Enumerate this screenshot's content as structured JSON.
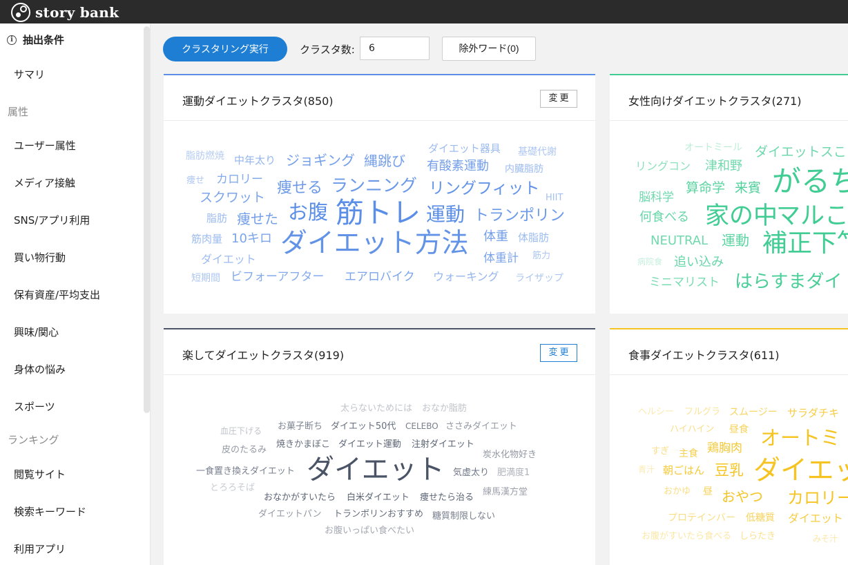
{
  "app": {
    "name": "story bank"
  },
  "sidebar": {
    "header": "抽出条件",
    "summary": "サマリ",
    "section_attr": "属性",
    "items_attr": [
      "ユーザー属性",
      "メディア接触",
      "SNS/アプリ利用",
      "買い物行動",
      "保有資産/平均支出",
      "興味/関心",
      "身体の悩み",
      "スポーツ"
    ],
    "section_rank": "ランキング",
    "items_rank": [
      "閲覧サイト",
      "検索キーワード",
      "利用アプリ"
    ]
  },
  "toolbar": {
    "run_label": "クラスタリング実行",
    "cluster_count_label": "クラスタ数:",
    "cluster_count_value": "6",
    "exclude_label": "除外ワード(0)"
  },
  "colors": {
    "blue": "#5b8ee6",
    "green": "#40cc92",
    "navy": "#4a5466",
    "yellow": "#f5c422",
    "accent": "#1e7ed4"
  },
  "clusters": [
    {
      "title": "運動ダイエットクラスタ(850)",
      "change_label": "変更",
      "words": [
        "脂肪燃焼",
        "中年太り",
        "ジョギング",
        "縄跳び",
        "ダイエット器具",
        "基礎代謝",
        "有酸素運動",
        "内臓脂肪",
        "痩せ",
        "カロリー",
        "痩せる",
        "ランニング",
        "リングフィット",
        "HIIT",
        "スクワット",
        "お腹",
        "筋トレ",
        "運動",
        "トランポリン",
        "脂肪",
        "痩せた",
        "筋肉量",
        "10キロ",
        "ダイエット方法",
        "体重",
        "体脂肪",
        "ダイエット",
        "体重計",
        "筋力",
        "短期間",
        "ビフォーアフター",
        "エアロバイク",
        "ウォーキング",
        "ライザップ"
      ]
    },
    {
      "title": "女性向けダイエットクラスタ(271)",
      "change_label": "",
      "words": [
        "オートミール",
        "ダイエットスこ",
        "リングコン",
        "津和野",
        "がるち",
        "脳科学",
        "算命学",
        "来賓",
        "何食べる",
        "家の中",
        "マルこ",
        "NEUTRAL",
        "運動",
        "補正下𥫗",
        "病院食",
        "追い込み",
        "ミニマリスト",
        "はらすまダイ"
      ]
    },
    {
      "title": "楽してダイエットクラスタ(919)",
      "change_label": "変更",
      "words": [
        "太らないためには",
        "おなか脂肪",
        "血圧下げる",
        "お菓子断ち",
        "ダイエット50代",
        "CELEBO",
        "ささみダイエット",
        "皮のたるみ",
        "焼きかまぼこ",
        "ダイエット運動",
        "注射ダイエット",
        "炭水化物好き",
        "一食置き換えダイエット",
        "ダイエット",
        "気虚太り",
        "肥満度1",
        "とろろそば",
        "おなかがすいたら",
        "白米ダイエット",
        "痩せたら治る",
        "練馬漢方堂",
        "ダイエットパン",
        "トランポリンおすすめ",
        "糖質制限しない",
        "お腹いっぱい食べたい"
      ]
    },
    {
      "title": "食事ダイエットクラスタ(611)",
      "change_label": "",
      "words": [
        "ヘルシー",
        "フルグラ",
        "スムージー",
        "サラダチキ",
        "ハイハイン",
        "昼食",
        "オートミ",
        "すぎ",
        "主食",
        "鶏胸肉",
        "青汁",
        "朝ごはん",
        "豆乳",
        "ダイエッ",
        "おかゆ",
        "昼",
        "おやつ",
        "カロリー",
        "プロテインバー",
        "低糖質",
        "ダイエット",
        "お腹がすいたら食べる",
        "しらたき",
        "みそ汁"
      ]
    }
  ]
}
